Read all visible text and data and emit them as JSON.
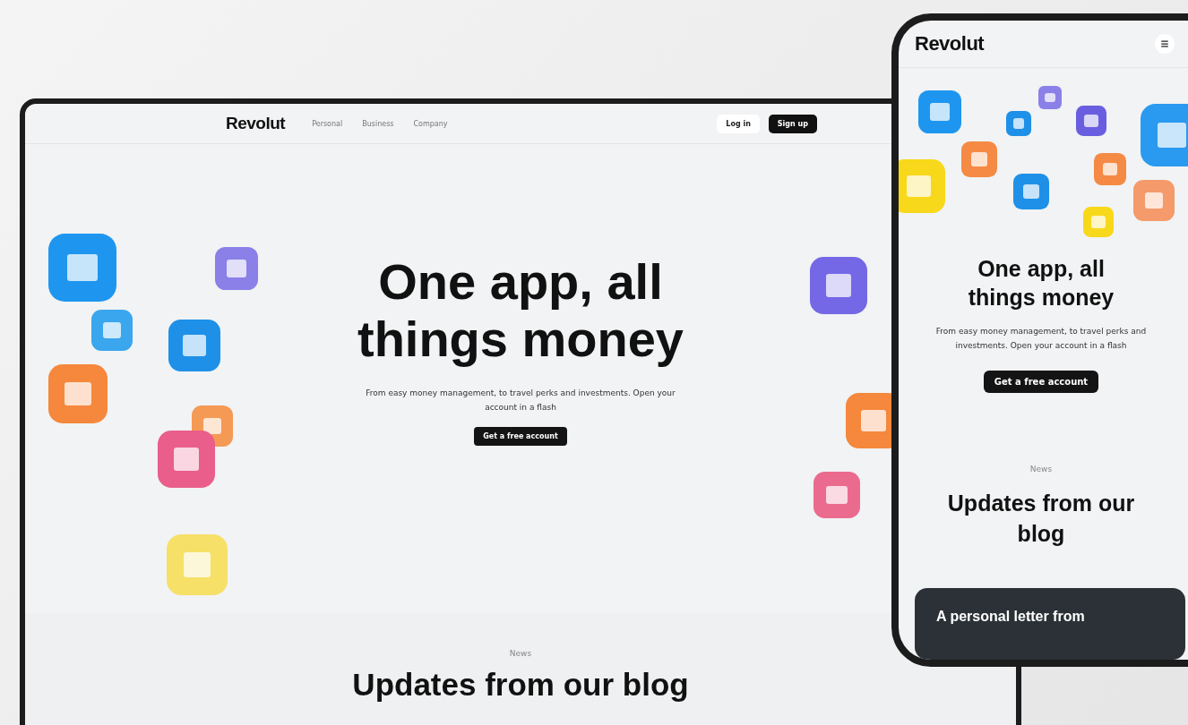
{
  "desktop": {
    "logo": "Revolut",
    "nav": [
      "Personal",
      "Business",
      "Company"
    ],
    "login": "Log in",
    "signup": "Sign up",
    "hero": {
      "title": "One app, all things money",
      "subtitle": "From easy money management, to travel perks and investments. Open your account in a flash",
      "cta": "Get a free account"
    },
    "news": {
      "eyebrow": "News",
      "title": "Updates from our blog"
    }
  },
  "mobile": {
    "logo": "Revolut",
    "hero": {
      "title": "One app, all things money",
      "subtitle": "From easy money management, to travel perks and investments. Open your account in a flash",
      "cta": "Get a free account"
    },
    "news": {
      "eyebrow": "News",
      "title": "Updates from our blog",
      "card_title": "A personal letter from"
    }
  }
}
